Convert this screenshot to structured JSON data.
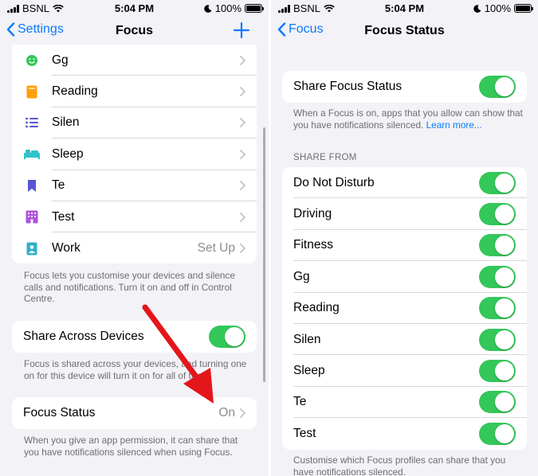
{
  "left": {
    "status": {
      "carrier": "BSNL",
      "time": "5:04 PM",
      "battery": "100%"
    },
    "nav": {
      "back_label": "Settings",
      "title": "Focus"
    },
    "focus_items": [
      {
        "label": "Gg",
        "value": "",
        "icon": "smiley-icon",
        "color": "#34c759"
      },
      {
        "label": "Reading",
        "value": "",
        "icon": "book-icon",
        "color": "#ff9f0a"
      },
      {
        "label": "Silen",
        "value": "",
        "icon": "list-icon",
        "color": "#5856d6"
      },
      {
        "label": "Sleep",
        "value": "",
        "icon": "bed-icon",
        "color": "#30c2c9"
      },
      {
        "label": "Te",
        "value": "",
        "icon": "bookmark-icon",
        "color": "#5856d6"
      },
      {
        "label": "Test",
        "value": "",
        "icon": "building-icon",
        "color": "#af52de"
      },
      {
        "label": "Work",
        "value": "Set Up",
        "icon": "badge-icon",
        "color": "#30b0c7"
      }
    ],
    "focus_note": "Focus lets you customise your devices and silence calls and notifications. Turn it on and off in Control Centre.",
    "share_across": {
      "label": "Share Across Devices",
      "on": true
    },
    "share_note": "Focus is shared across your devices, and turning one on for this device will turn it on for all of them.",
    "focus_status": {
      "label": "Focus Status",
      "value": "On"
    },
    "status_note": "When you give an app permission, it can share that you have notifications silenced when using Focus."
  },
  "right": {
    "status": {
      "carrier": "BSNL",
      "time": "5:04 PM",
      "battery": "100%"
    },
    "nav": {
      "back_label": "Focus",
      "title": "Focus Status"
    },
    "share_status": {
      "label": "Share Focus Status",
      "on": true
    },
    "share_note": "When a Focus is on, apps that you allow can show that you have notifications silenced.",
    "learn_more": "Learn more...",
    "share_from_header": "SHARE FROM",
    "share_from": [
      {
        "label": "Do Not Disturb",
        "on": true
      },
      {
        "label": "Driving",
        "on": true
      },
      {
        "label": "Fitness",
        "on": true
      },
      {
        "label": "Gg",
        "on": true
      },
      {
        "label": "Reading",
        "on": true
      },
      {
        "label": "Silen",
        "on": true
      },
      {
        "label": "Sleep",
        "on": true
      },
      {
        "label": "Te",
        "on": true
      },
      {
        "label": "Test",
        "on": true
      }
    ],
    "bottom_note": "Customise which Focus profiles can share that you have notifications silenced."
  },
  "colors": {
    "accent": "#0a7aff",
    "toggle_on": "#34c759",
    "arrow": "#e3161b"
  }
}
